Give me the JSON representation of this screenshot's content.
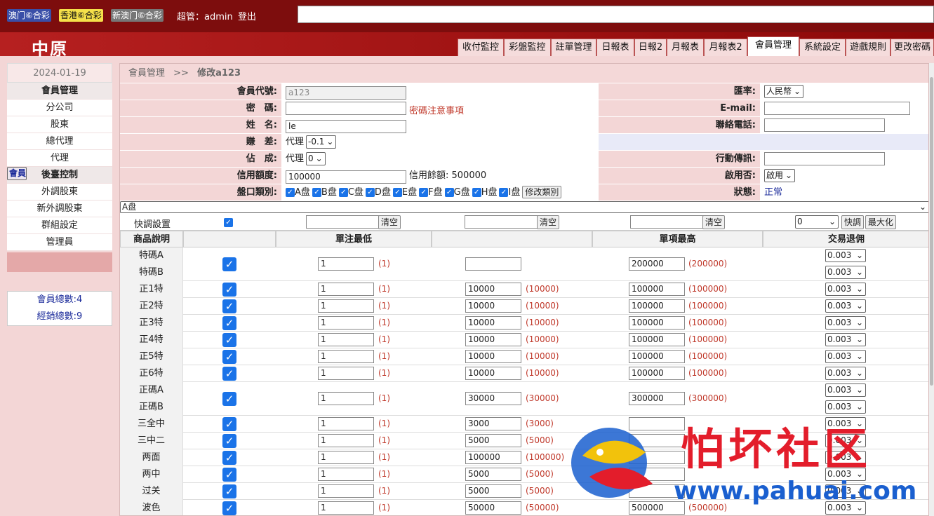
{
  "topbar": {
    "lotteries": [
      "澳门⑥合彩",
      "香港⑥合彩",
      "新澳门⑥合彩"
    ],
    "user": "超管：admin",
    "logout": "登出"
  },
  "brand": "中原",
  "tabs": [
    "收付監控",
    "彩盤監控",
    "註單管理",
    "日報表",
    "日報2",
    "月報表",
    "月報表2",
    "會員管理",
    "系統設定",
    "遊戲規則",
    "更改密碼"
  ],
  "sidebar": {
    "date": "2024-01-19",
    "sections": [
      {
        "header": "會員管理",
        "items": [
          "分公司",
          "股東",
          "總代理",
          "代理",
          "會員"
        ]
      },
      {
        "header": "後臺控制",
        "items": [
          "外調股東",
          "新外調股東",
          "群組設定",
          "管理員"
        ]
      }
    ],
    "stats": [
      "會員總數:4",
      "經銷總數:9"
    ]
  },
  "breadcrumb": {
    "root": "會員管理",
    "sep": ">>",
    "current": "修改a123"
  },
  "form": {
    "left": [
      {
        "label": "會員代號:",
        "value": "a123"
      },
      {
        "label": "密　碼:",
        "value": "",
        "note": "密碼注意事項"
      },
      {
        "label": "姓　名:",
        "value": "le"
      },
      {
        "label": "賺　差:",
        "prefix": "代理",
        "select": "-0.1"
      },
      {
        "label": "佔　成:",
        "prefix": "代理",
        "select": "0"
      },
      {
        "label": "信用額度:",
        "value": "100000",
        "note": "信用餘額: 500000"
      },
      {
        "label": "盤口類別:",
        "checks": [
          "A盘",
          "B盘",
          "C盘",
          "D盘",
          "E盘",
          "F盘",
          "G盘",
          "H盘",
          "I盘"
        ],
        "button": "修改類別"
      }
    ],
    "right": [
      {
        "label": "匯率:",
        "select": "人民幣"
      },
      {
        "label": "E-mail:",
        "value": ""
      },
      {
        "label": "聯絡電話:",
        "value": ""
      },
      {
        "label": "",
        "value": ""
      },
      {
        "label": "行動傳訊:",
        "value": ""
      },
      {
        "label": "啟用否:",
        "select": "啟用"
      },
      {
        "label": "狀態:",
        "value": "正常"
      }
    ]
  },
  "pan_select": "A盘",
  "quick": {
    "label": "快調設置",
    "clear1": "清空",
    "clear2": "清空",
    "clear3": "清空",
    "select": "0",
    "apply": "快調",
    "maximize": "最大化"
  },
  "grid": {
    "headers": [
      "商品說明",
      "",
      "單注最低",
      "",
      "單項最高",
      "交易退佣"
    ],
    "rows": [
      {
        "names": [
          "特碼A",
          "特碼B"
        ],
        "min": "1",
        "minp": "(1)",
        "mid": "",
        "midp": "",
        "max": "200000",
        "maxp": "(200000)",
        "rebate": [
          "0.003",
          "0.003"
        ]
      },
      {
        "names": [
          "正1特"
        ],
        "min": "1",
        "minp": "(1)",
        "mid": "10000",
        "midp": "(10000)",
        "max": "100000",
        "maxp": "(100000)",
        "rebate": [
          "0.003"
        ]
      },
      {
        "names": [
          "正2特"
        ],
        "min": "1",
        "minp": "(1)",
        "mid": "10000",
        "midp": "(10000)",
        "max": "100000",
        "maxp": "(100000)",
        "rebate": [
          "0.003"
        ]
      },
      {
        "names": [
          "正3特"
        ],
        "min": "1",
        "minp": "(1)",
        "mid": "10000",
        "midp": "(10000)",
        "max": "100000",
        "maxp": "(100000)",
        "rebate": [
          "0.003"
        ]
      },
      {
        "names": [
          "正4特"
        ],
        "min": "1",
        "minp": "(1)",
        "mid": "10000",
        "midp": "(10000)",
        "max": "100000",
        "maxp": "(100000)",
        "rebate": [
          "0.003"
        ]
      },
      {
        "names": [
          "正5特"
        ],
        "min": "1",
        "minp": "(1)",
        "mid": "10000",
        "midp": "(10000)",
        "max": "100000",
        "maxp": "(100000)",
        "rebate": [
          "0.003"
        ]
      },
      {
        "names": [
          "正6特"
        ],
        "min": "1",
        "minp": "(1)",
        "mid": "10000",
        "midp": "(10000)",
        "max": "100000",
        "maxp": "(100000)",
        "rebate": [
          "0.003"
        ]
      },
      {
        "names": [
          "正碼A",
          "正碼B"
        ],
        "min": "1",
        "minp": "(1)",
        "mid": "30000",
        "midp": "(30000)",
        "max": "300000",
        "maxp": "(300000)",
        "rebate": [
          "0.003",
          "0.003"
        ]
      },
      {
        "names": [
          "三全中"
        ],
        "min": "1",
        "minp": "(1)",
        "mid": "3000",
        "midp": "(3000)",
        "max": "",
        "maxp": "",
        "rebate": [
          "0.003"
        ]
      },
      {
        "names": [
          "三中二"
        ],
        "min": "1",
        "minp": "(1)",
        "mid": "5000",
        "midp": "(5000)",
        "max": "",
        "maxp": "",
        "rebate": [
          "0.003"
        ]
      },
      {
        "names": [
          "两面"
        ],
        "min": "1",
        "minp": "(1)",
        "mid": "100000",
        "midp": "(100000)",
        "max": "",
        "maxp": "",
        "rebate": [
          "0.003"
        ]
      },
      {
        "names": [
          "两中"
        ],
        "min": "1",
        "minp": "(1)",
        "mid": "5000",
        "midp": "(5000)",
        "max": "",
        "maxp": "",
        "rebate": [
          "0.003"
        ]
      },
      {
        "names": [
          "过关"
        ],
        "min": "1",
        "minp": "(1)",
        "mid": "5000",
        "midp": "(5000)",
        "max": "",
        "maxp": "",
        "rebate": [
          "0.003"
        ]
      },
      {
        "names": [
          "波色"
        ],
        "min": "1",
        "minp": "(1)",
        "mid": "50000",
        "midp": "(50000)",
        "max": "500000",
        "maxp": "(500000)",
        "rebate": [
          "0.003"
        ]
      }
    ]
  },
  "watermark": {
    "cn": "怕坏社区",
    "url": "www.pahuai.com"
  },
  "colors": {
    "topbar": "#7d0d0d",
    "accent": "#1a73e8",
    "panel": "#f3d6d6",
    "note": "#c0392b"
  }
}
